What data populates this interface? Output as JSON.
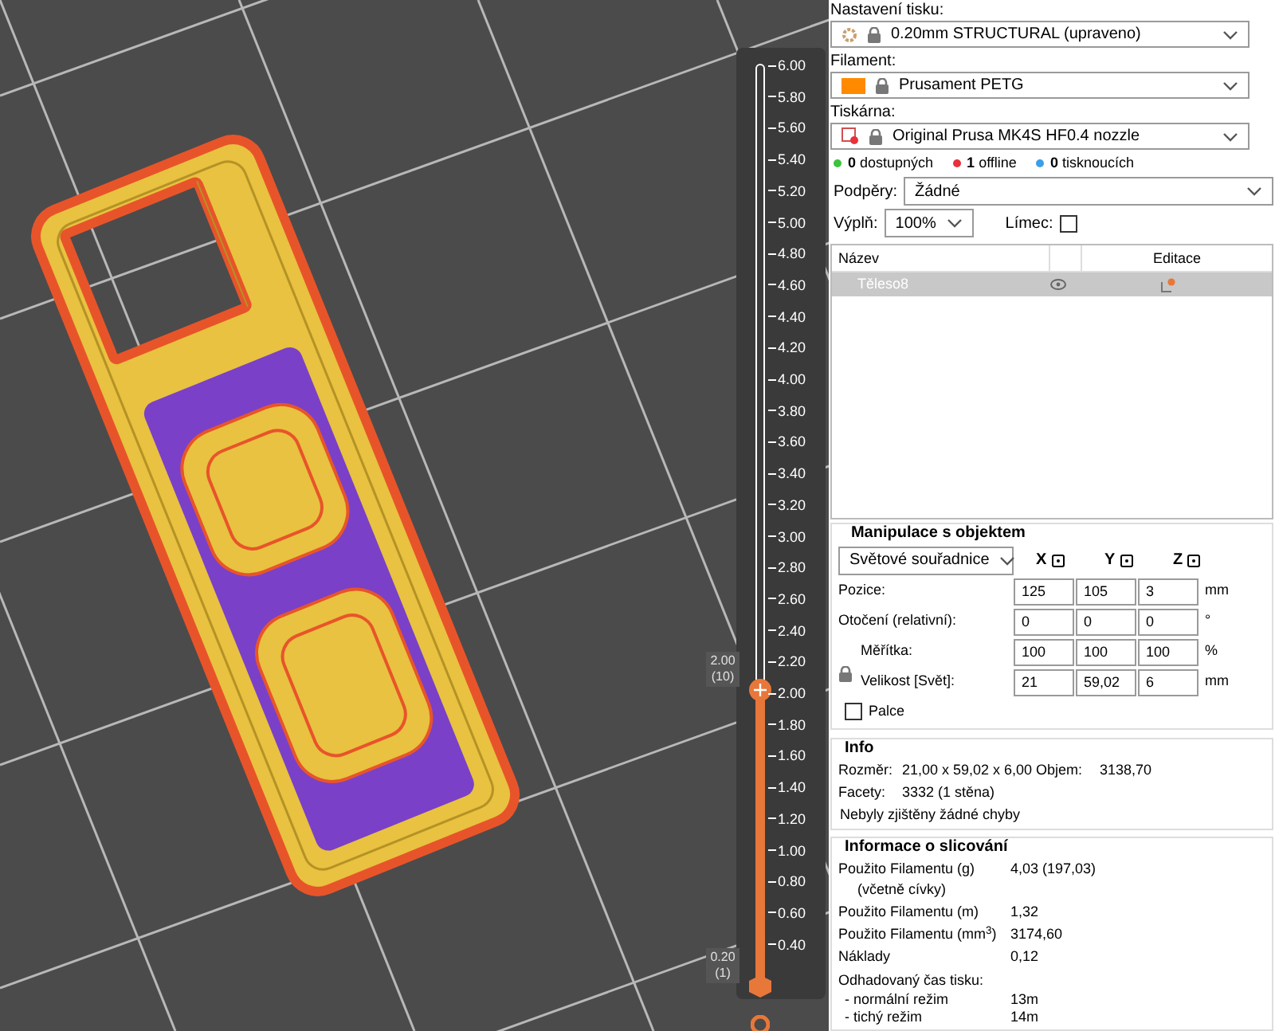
{
  "slider": {
    "ticks": [
      "6.00",
      "5.80",
      "5.60",
      "5.40",
      "5.20",
      "5.00",
      "4.80",
      "4.60",
      "4.40",
      "4.20",
      "4.00",
      "3.80",
      "3.60",
      "3.40",
      "3.20",
      "3.00",
      "2.80",
      "2.60",
      "2.40",
      "2.20",
      "2.00",
      "1.80",
      "1.60",
      "1.40",
      "1.20",
      "1.00",
      "0.80",
      "0.60",
      "0.40"
    ],
    "level": 0.32,
    "upper_value": "2.00",
    "upper_layer": "(10)",
    "lower_value": "0.20",
    "lower_layer": "(1)"
  },
  "print_settings": {
    "label": "Nastavení tisku:",
    "value": "0.20mm STRUCTURAL (upraveno)"
  },
  "filament": {
    "label": "Filament:",
    "value": "Prusament PETG",
    "color": "#ff8a00"
  },
  "printer": {
    "label": "Tiskárna:",
    "value": "Original Prusa MK4S HF0.4 nozzle"
  },
  "printer_status": [
    {
      "count": "0",
      "label": "dostupných",
      "color": "#3cc43c"
    },
    {
      "count": "1",
      "label": "offline",
      "color": "#e8313a"
    },
    {
      "count": "0",
      "label": "tisknoucích",
      "color": "#3b9fe8"
    }
  ],
  "supports": {
    "label": "Podpěry:",
    "value": "Žádné"
  },
  "infill": {
    "label": "Výplň:",
    "value": "100%"
  },
  "brim": {
    "label": "Límec:",
    "checked": false
  },
  "object_list": {
    "columns": [
      "Název",
      "Editace"
    ],
    "rows": [
      {
        "name": "Těleso8",
        "selected": true
      }
    ]
  },
  "manipulation": {
    "title": "Manipulace s objektem",
    "coordinates": "Světové souřadnice",
    "axes": [
      "X",
      "Y",
      "Z"
    ],
    "rows": [
      {
        "label": "Pozice:",
        "values": [
          "125",
          "105",
          "3"
        ],
        "unit": "mm"
      },
      {
        "label": "Otočení (relativní):",
        "values": [
          "0",
          "0",
          "0"
        ],
        "unit": "°"
      },
      {
        "label": "Měřítka:",
        "values": [
          "100",
          "100",
          "100"
        ],
        "unit": "%"
      },
      {
        "label": "Velikost [Svět]:",
        "values": [
          "21",
          "59,02",
          "6"
        ],
        "unit": "mm"
      }
    ],
    "inches": {
      "label": "Palce",
      "checked": false
    }
  },
  "info": {
    "title": "Info",
    "size_label": "Rozměr:",
    "size": "21,00 x 59,02 x 6,00",
    "volume_label": "Objem:",
    "volume": "3138,70",
    "facets_label": "Facety:",
    "facets": "3332 (1 stěna)",
    "message": "Nebyly zjištěny žádné chyby"
  },
  "slicing": {
    "title": "Informace o slicování",
    "rows": [
      {
        "label": "Použito Filamentu (g)",
        "sub": "(včetně cívky)",
        "value": "4,03 (197,03)"
      },
      {
        "label": "Použito Filamentu (m)",
        "value": "1,32"
      },
      {
        "label": "Použito Filamentu (mm$^{3}$)",
        "value": "3174,60"
      },
      {
        "label": "Náklady",
        "value": "0,12"
      }
    ],
    "time_title": "Odhadovaný čas tisku:",
    "times": [
      {
        "label": "- normální režim",
        "value": "13m"
      },
      {
        "label": "- tichý režim",
        "value": "14m"
      }
    ]
  }
}
